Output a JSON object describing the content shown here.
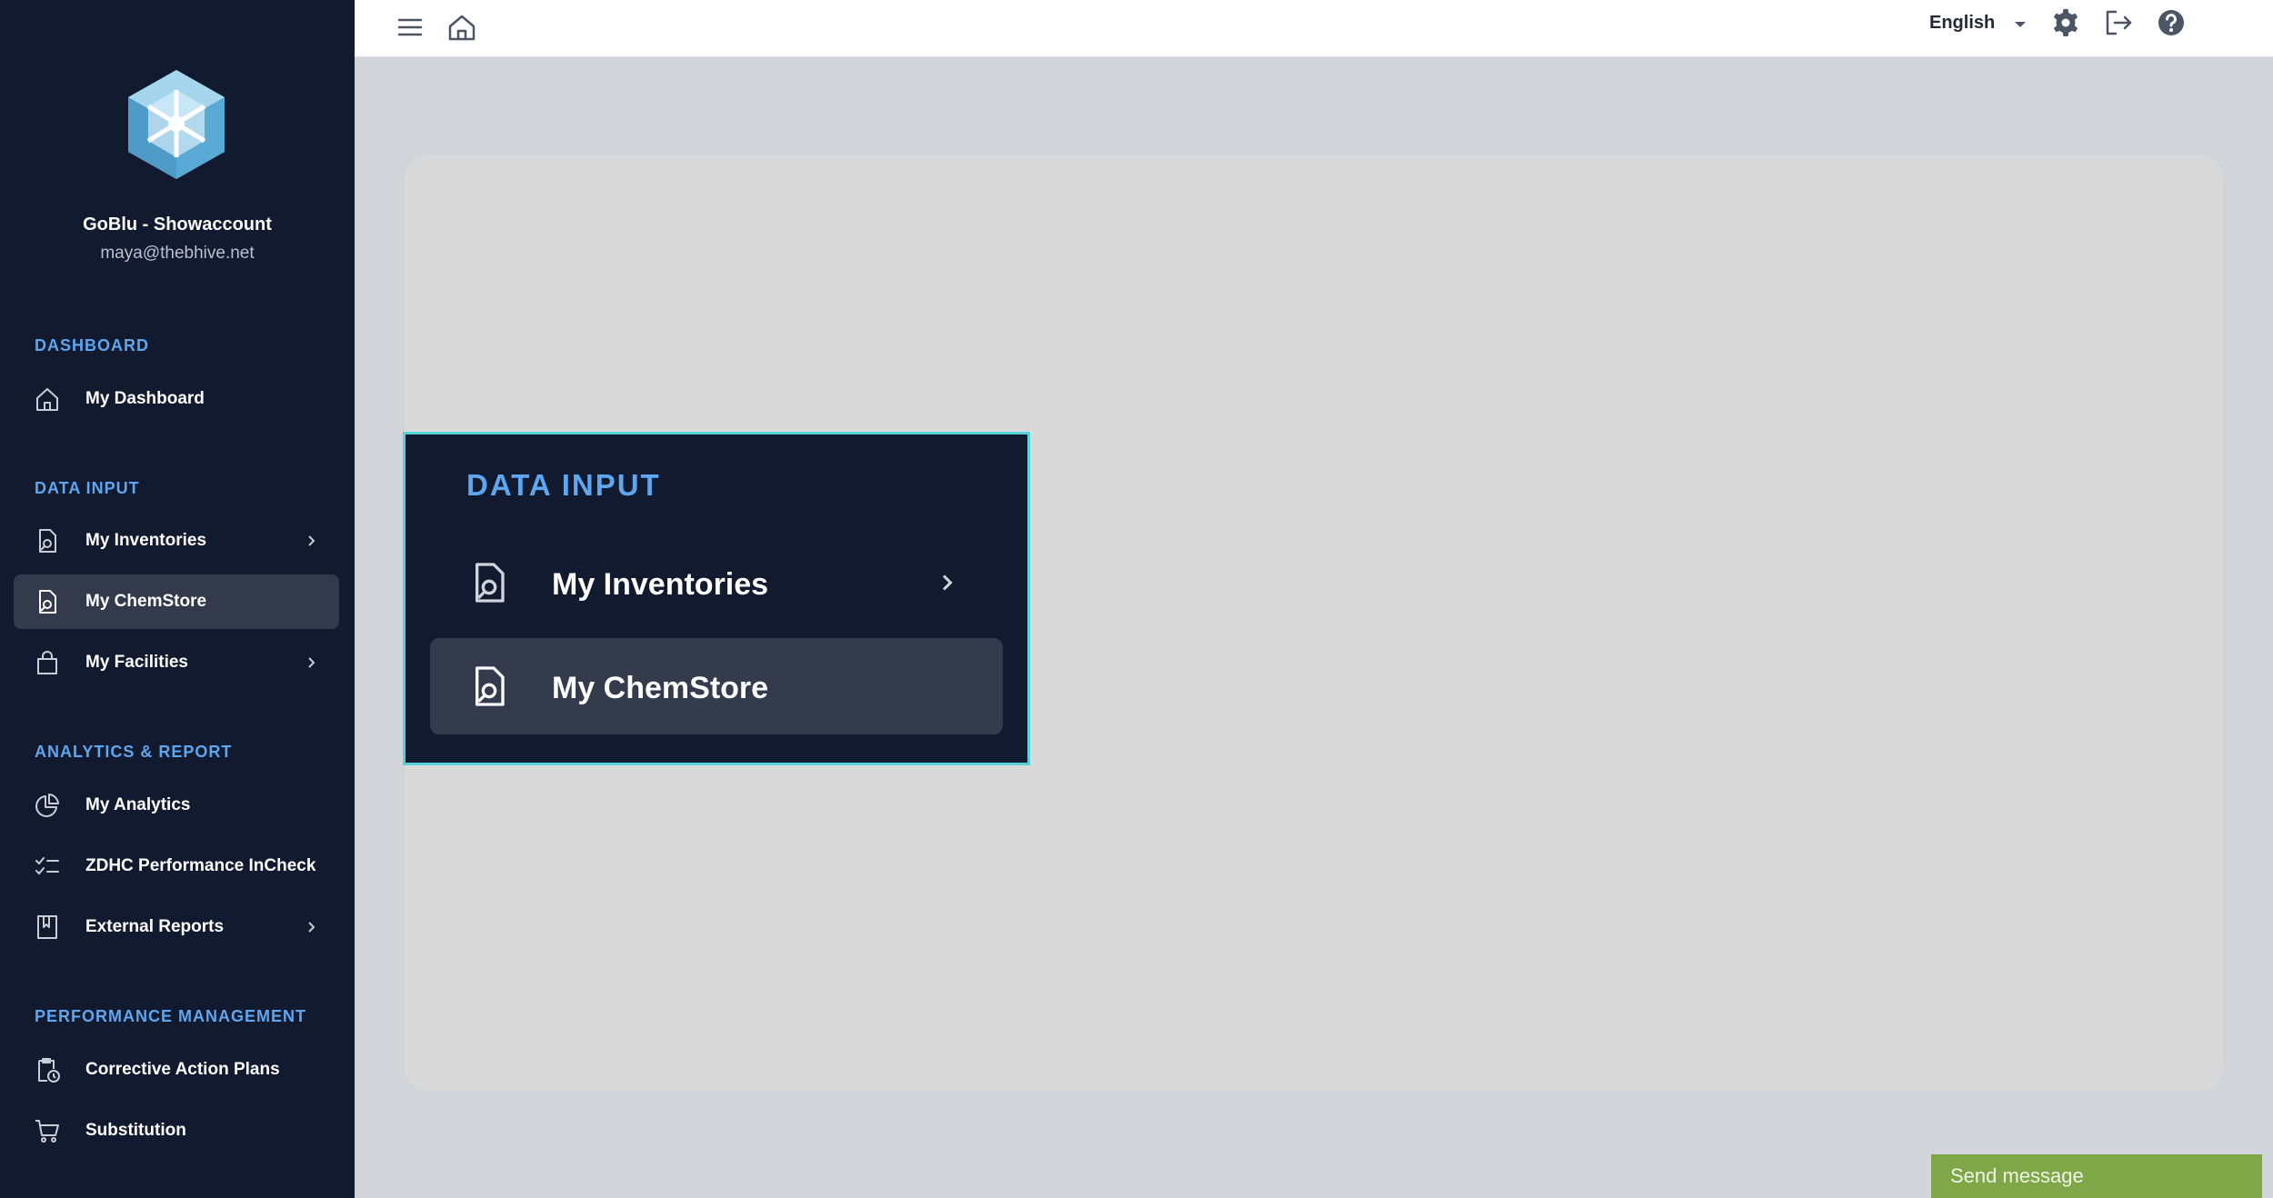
{
  "account": {
    "name": "GoBlu - Showaccount",
    "email": "maya@thebhive.net"
  },
  "sidebar": {
    "sections": [
      {
        "title": "DASHBOARD",
        "items": [
          {
            "label": "My Dashboard",
            "icon": "home-icon"
          }
        ]
      },
      {
        "title": "DATA INPUT",
        "items": [
          {
            "label": "My Inventories",
            "icon": "document-search-icon",
            "chevron": true
          },
          {
            "label": "My ChemStore",
            "icon": "document-search-icon",
            "active": true
          },
          {
            "label": "My Facilities",
            "icon": "shopping-bag-icon",
            "chevron": true
          }
        ]
      },
      {
        "title": "ANALYTICS & REPORT",
        "items": [
          {
            "label": "My Analytics",
            "icon": "pie-chart-icon"
          },
          {
            "label": "ZDHC Performance InCheck",
            "icon": "checklist-icon"
          },
          {
            "label": "External Reports",
            "icon": "book-icon",
            "chevron": true
          }
        ]
      },
      {
        "title": "PERFORMANCE MANAGEMENT",
        "items": [
          {
            "label": "Corrective Action Plans",
            "icon": "clipboard-clock-icon"
          },
          {
            "label": "Substitution",
            "icon": "shopping-cart-icon"
          }
        ]
      }
    ]
  },
  "topbar": {
    "language": "English",
    "icons": [
      "menu-icon",
      "home-icon",
      "chevron-down-icon",
      "gear-icon",
      "logout-icon",
      "help-icon"
    ]
  },
  "callout": {
    "title": "DATA INPUT",
    "items": [
      {
        "label": "My Inventories",
        "chevron": true
      },
      {
        "label": "My ChemStore",
        "active": true
      }
    ]
  },
  "chat": {
    "send_label": "Send message"
  },
  "colors": {
    "sidebar_bg": "#111a2e",
    "section_title": "#5fa6f0",
    "active_item": "#323a4b",
    "callout_border": "#55d3d8",
    "send_button": "#7fa748"
  }
}
